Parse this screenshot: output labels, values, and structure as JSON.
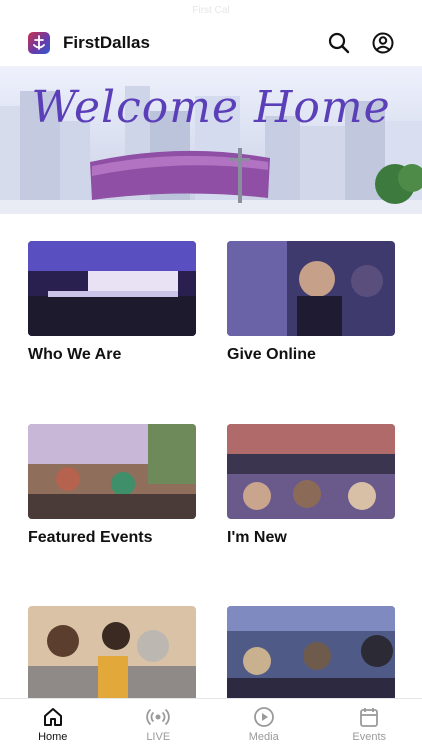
{
  "status_bar": {
    "text": "First Cal"
  },
  "header": {
    "brand": "FirstDallas"
  },
  "hero": {
    "title": "Welcome Home"
  },
  "cards": [
    {
      "label": "Who We Are"
    },
    {
      "label": "Give Online"
    },
    {
      "label": "Featured Events"
    },
    {
      "label": "I'm New"
    },
    {
      "label": ""
    },
    {
      "label": ""
    }
  ],
  "tabbar": {
    "items": [
      {
        "label": "Home",
        "icon": "home-icon",
        "active": true
      },
      {
        "label": "LIVE",
        "icon": "live-broadcast-icon",
        "active": false
      },
      {
        "label": "Media",
        "icon": "play-icon",
        "active": false
      },
      {
        "label": "Events",
        "icon": "calendar-icon",
        "active": false
      }
    ]
  },
  "colors": {
    "accent": "#5b3fb8",
    "text": "#111111",
    "inactive": "#9a9a9a"
  }
}
